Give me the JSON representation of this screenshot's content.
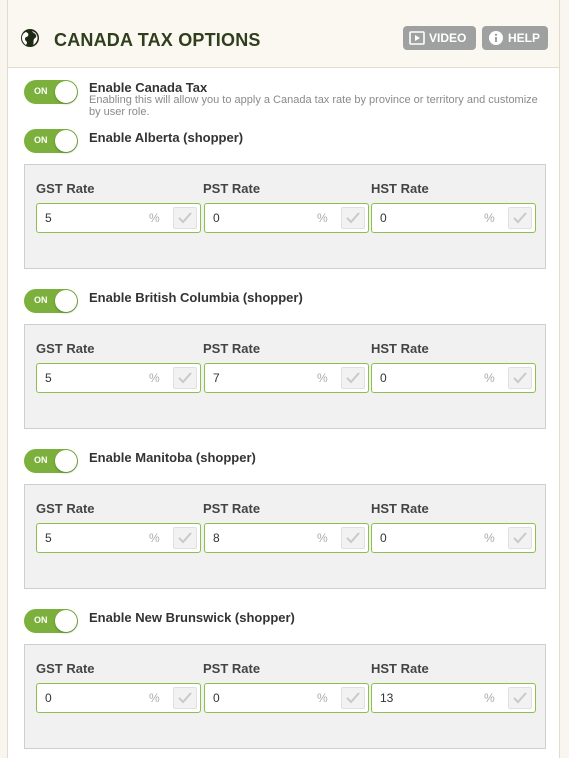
{
  "header": {
    "title": "CANADA TAX OPTIONS",
    "video_label": "VIDEO",
    "help_label": "HELP"
  },
  "enable_canada": {
    "toggle": "ON",
    "label": "Enable Canada Tax",
    "description": "Enabling this will allow you to apply a Canada tax rate by province or territory and customize by user role."
  },
  "provinces": [
    {
      "toggle": "ON",
      "label": "Enable Alberta (shopper)",
      "gst_label": "GST Rate",
      "gst": "5",
      "pst_label": "PST Rate",
      "pst": "0",
      "hst_label": "HST Rate",
      "hst": "0"
    },
    {
      "toggle": "ON",
      "label": "Enable British Columbia (shopper)",
      "gst_label": "GST Rate",
      "gst": "5",
      "pst_label": "PST Rate",
      "pst": "7",
      "hst_label": "HST Rate",
      "hst": "0"
    },
    {
      "toggle": "ON",
      "label": "Enable Manitoba (shopper)",
      "gst_label": "GST Rate",
      "gst": "5",
      "pst_label": "PST Rate",
      "pst": "8",
      "hst_label": "HST Rate",
      "hst": "0"
    },
    {
      "toggle": "ON",
      "label": "Enable New Brunswick (shopper)",
      "gst_label": "GST Rate",
      "gst": "0",
      "pst_label": "PST Rate",
      "pst": "0",
      "hst_label": "HST Rate",
      "hst": "13"
    }
  ],
  "percent_symbol": "%",
  "colors": {
    "toggle_on": "#7ab03b",
    "field_border": "#8cc04b",
    "header_button": "#9fa1a0",
    "title": "#2f3e1d"
  }
}
